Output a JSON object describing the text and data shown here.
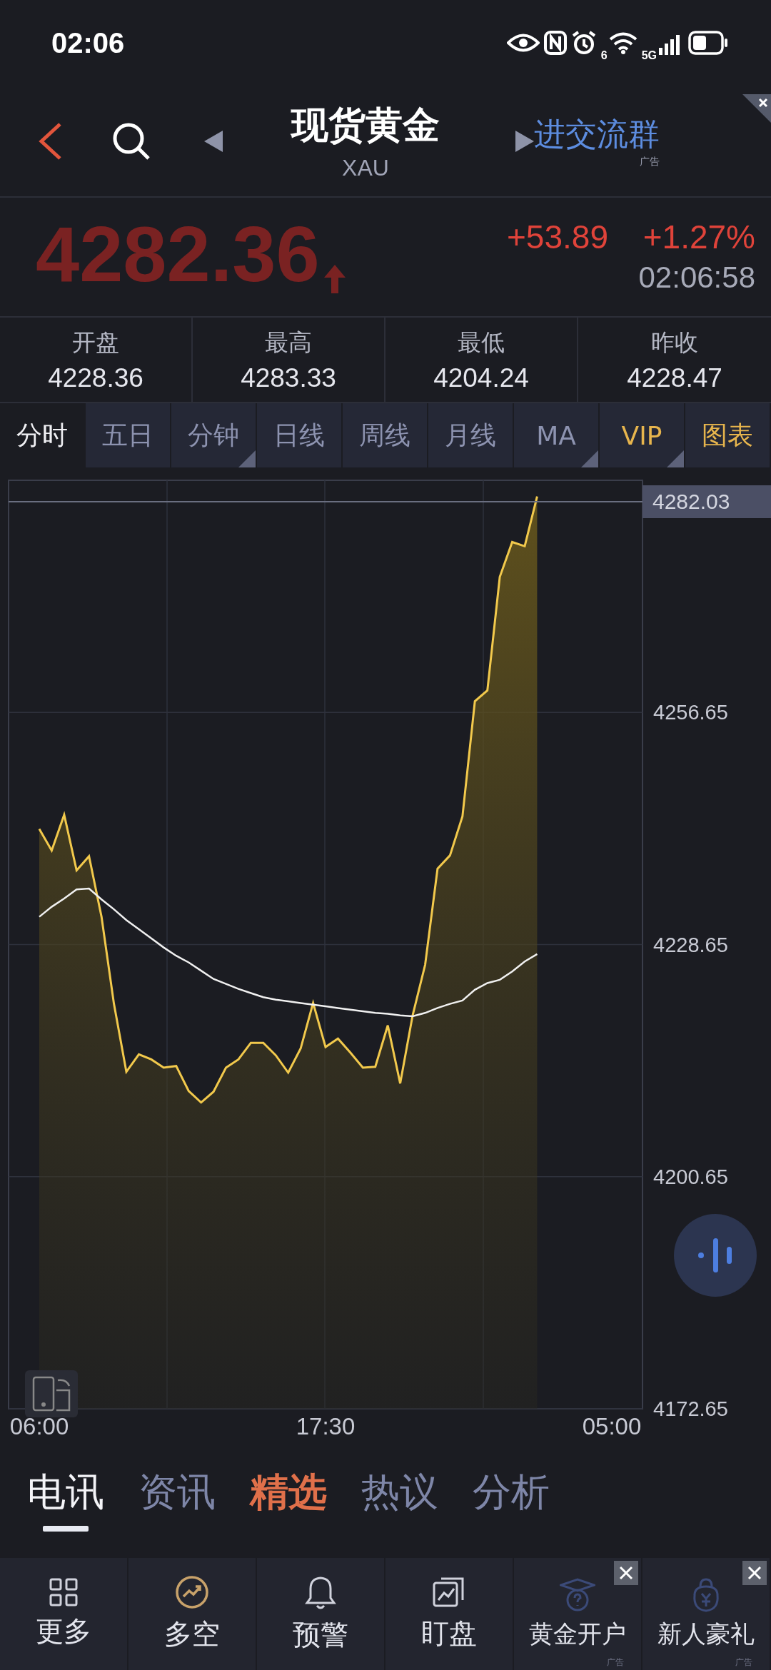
{
  "status_bar": {
    "time": "02:06",
    "wifi_badge": "6",
    "network": "5G"
  },
  "header": {
    "title": "现货黄金",
    "subtitle": "XAU",
    "ad_link": "进交流群",
    "ad_label": "广告"
  },
  "quote": {
    "price": "4282.36",
    "change": "+53.89",
    "change_percent": "+1.27%",
    "time": "02:06:58"
  },
  "stats": [
    {
      "label": "开盘",
      "value": "4228.36"
    },
    {
      "label": "最高",
      "value": "4283.33"
    },
    {
      "label": "最低",
      "value": "4204.24"
    },
    {
      "label": "昨收",
      "value": "4228.47"
    }
  ],
  "period_tabs": [
    {
      "label": "分时",
      "selected": true,
      "kind": "plain",
      "dropdown": false
    },
    {
      "label": "五日",
      "selected": false,
      "kind": "plain",
      "dropdown": false
    },
    {
      "label": "分钟",
      "selected": false,
      "kind": "plain",
      "dropdown": true
    },
    {
      "label": "日线",
      "selected": false,
      "kind": "plain",
      "dropdown": false
    },
    {
      "label": "周线",
      "selected": false,
      "kind": "plain",
      "dropdown": false
    },
    {
      "label": "月线",
      "selected": false,
      "kind": "plain",
      "dropdown": false
    },
    {
      "label": "MA",
      "selected": false,
      "kind": "plain",
      "dropdown": true
    },
    {
      "label": "VIP",
      "selected": false,
      "kind": "gold",
      "dropdown": true
    },
    {
      "label": "图表",
      "selected": false,
      "kind": "gold",
      "dropdown": false
    }
  ],
  "chart": {
    "price_marker": "4282.03",
    "chart_data": {
      "type": "area",
      "grid": true,
      "categories": [
        "06:00",
        null,
        null,
        null,
        null,
        null,
        null,
        null,
        null,
        null,
        null,
        null,
        null,
        null,
        null,
        null,
        null,
        null,
        null,
        null,
        null,
        null,
        null,
        "17:30",
        null,
        null,
        null,
        null,
        null,
        null,
        null,
        null,
        null,
        null,
        null,
        null,
        null,
        null,
        null,
        null,
        null,
        null,
        null,
        null,
        null,
        null,
        "05:00"
      ],
      "ylim": [
        4172.65,
        4284.65
      ],
      "yticks": [
        4256.65,
        4228.65,
        4200.65,
        4172.65
      ],
      "series": [
        {
          "color": "#f2c94c",
          "values": [
            4242.6,
            4240.0,
            4244.3,
            4237.6,
            4239.3,
            4232.0,
            4221.5,
            4213.3,
            4215.4,
            4214.8,
            4213.8,
            4214.0,
            4211.0,
            4209.6,
            4210.9,
            4213.8,
            4214.8,
            4216.8,
            4216.8,
            4215.3,
            4213.2,
            4216.1,
            4221.6,
            4216.3,
            4217.3,
            4215.6,
            4213.8,
            4213.9,
            4218.9,
            4211.9,
            4220.1,
            4226.2,
            4237.8,
            4239.4,
            4244.1,
            4258.0,
            4259.3,
            4273.0,
            4277.2,
            4276.7,
            4282.7,
            null,
            null,
            null,
            null,
            null,
            null
          ]
        },
        {
          "type": "line",
          "color": "#f0f0f0",
          "values": [
            4232.0,
            4233.2,
            4234.2,
            4235.3,
            4235.4,
            4234.1,
            4232.9,
            4231.6,
            4230.5,
            4229.4,
            4228.3,
            4227.3,
            4226.5,
            4225.5,
            4224.5,
            4223.9,
            4223.3,
            4222.8,
            4222.3,
            4222.0,
            4221.8,
            4221.6,
            4221.4,
            4221.2,
            4221.0,
            4220.8,
            4220.6,
            4220.4,
            4220.3,
            4220.1,
            4220.0,
            4220.4,
            4221.0,
            4221.5,
            4221.9,
            4223.2,
            4224.0,
            4224.4,
            4225.4,
            4226.6,
            4227.5,
            null,
            null,
            null,
            null,
            null,
            null
          ]
        }
      ]
    }
  },
  "news_tabs": [
    {
      "label": "电讯",
      "selected": true,
      "kind": "plain"
    },
    {
      "label": "资讯",
      "selected": false,
      "kind": "plain"
    },
    {
      "label": "精选",
      "selected": false,
      "kind": "hot"
    },
    {
      "label": "热议",
      "selected": false,
      "kind": "plain"
    },
    {
      "label": "分析",
      "selected": false,
      "kind": "plain"
    }
  ],
  "bottom_nav": [
    {
      "label": "更多",
      "kind": "grid"
    },
    {
      "label": "多空",
      "kind": "trend"
    },
    {
      "label": "预警",
      "kind": "bell"
    },
    {
      "label": "盯盘",
      "kind": "monitor"
    },
    {
      "label": "黄金开户",
      "kind": "cap",
      "ad_label": "广告"
    },
    {
      "label": "新人豪礼",
      "kind": "bag",
      "ad_label": "广告"
    }
  ]
}
